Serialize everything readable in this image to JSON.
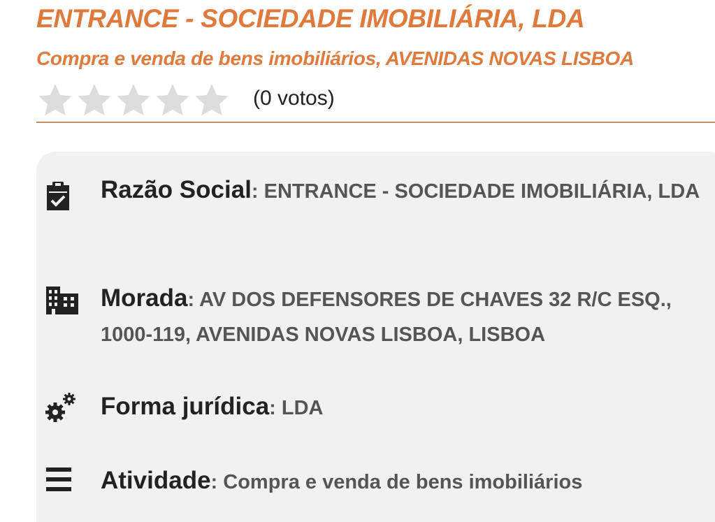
{
  "header": {
    "title": "ENTRANCE - SOCIEDADE IMOBILIÁRIA, LDA",
    "subtitle": "Compra e venda de bens imobiliários, AVENIDAS NOVAS LISBOA"
  },
  "rating": {
    "stars_filled": 0,
    "stars_total": 5,
    "votes_text": "(0 votos)"
  },
  "details": [
    {
      "icon": "clipboard-check-icon",
      "label": "Razão Social",
      "separator": ": ",
      "value": "ENTRANCE - SOCIEDADE IMOBILIÁRIA, LDA"
    },
    {
      "icon": "building-icon",
      "label": "Morada",
      "separator": ": ",
      "value": "AV DOS DEFENSORES DE CHAVES 32 R/C ESQ., 1000-119, AVENIDAS NOVAS LISBOA, LISBOA"
    },
    {
      "icon": "gears-icon",
      "label": "Forma jurídica",
      "separator": ": ",
      "value": "LDA"
    },
    {
      "icon": "list-icon",
      "label": "Atividade",
      "separator": ": ",
      "value": "Compra e venda de bens imobiliários"
    }
  ],
  "colors": {
    "accent": "#e07a3c",
    "divider": "#c98b5f",
    "card_bg": "#f1f1f1",
    "star_empty": "#dcdcdc",
    "label": "#222222",
    "value": "#555555"
  }
}
